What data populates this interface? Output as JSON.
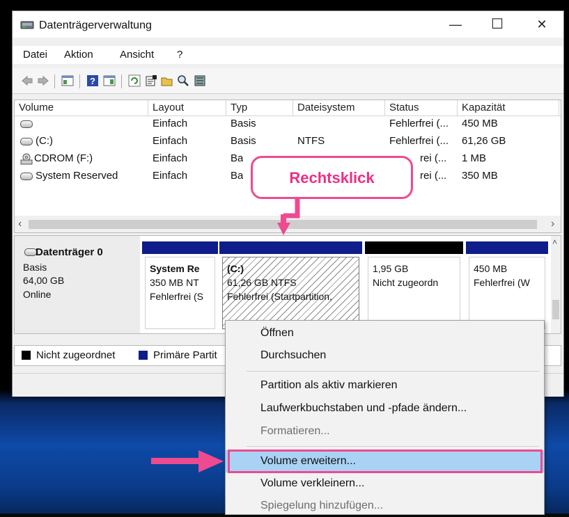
{
  "window": {
    "title": "Datenträgerverwaltung",
    "controls": {
      "minimize": "—",
      "maximize": "☐",
      "close": "✕"
    }
  },
  "menu": [
    "Datei",
    "Aktion",
    "Ansicht",
    "?"
  ],
  "list": {
    "columns": [
      "Volume",
      "Layout",
      "Typ",
      "Dateisystem",
      "Status",
      "Kapazität"
    ],
    "rows": [
      {
        "volume": "",
        "layout": "Einfach",
        "type": "Basis",
        "fs": "",
        "status": "Fehlerfrei (...",
        "cap": "450 MB"
      },
      {
        "volume": "(C:)",
        "layout": "Einfach",
        "type": "Basis",
        "fs": "NTFS",
        "status": "Fehlerfrei (...",
        "cap": "61,26 GB"
      },
      {
        "volume": "CDROM (F:)",
        "layout": "Einfach",
        "type": "Ba",
        "fs": "",
        "status": "rei (...",
        "cap": "1 MB"
      },
      {
        "volume": "System Reserved",
        "layout": "Einfach",
        "type": "Ba",
        "fs": "",
        "status": "rei (...",
        "cap": "350 MB"
      }
    ]
  },
  "disk": {
    "name": "Datenträger 0",
    "type": "Basis",
    "size": "64,00 GB",
    "state": "Online",
    "partitions": [
      {
        "l1": "System Re",
        "l2": "350 MB NT",
        "l3": "Fehlerfrei (S",
        "bar_color": "#0f1d8a"
      },
      {
        "l1": "(C:)",
        "l2": "61,26 GB NTFS",
        "l3": "Fehlerfrei (Startpartition,",
        "bar_color": "#0f1d8a"
      },
      {
        "l1": "",
        "l2": "1,95 GB",
        "l3": "Nicht zugeordn",
        "bar_color": "#000000"
      },
      {
        "l1": "",
        "l2": "450 MB",
        "l3": "Fehlerfrei (W",
        "bar_color": "#0f1d8a"
      }
    ]
  },
  "legend": {
    "unallocated": "Nicht zugeordnet",
    "primary": "Primäre Partit"
  },
  "context_menu": {
    "items": [
      "Öffnen",
      "Durchsuchen",
      "Partition als aktiv markieren",
      "Laufwerkbuchstaben und -pfade ändern...",
      "Formatieren...",
      "Volume erweitern...",
      "Volume verkleinern...",
      "Spiegelung hinzufügen..."
    ],
    "disabled": [
      "Formatieren...",
      "Spiegelung hinzufügen..."
    ],
    "highlighted": "Volume erweitern..."
  },
  "annotation": {
    "callout": "Rechtsklick",
    "accent_color": "#ee4a8f"
  }
}
